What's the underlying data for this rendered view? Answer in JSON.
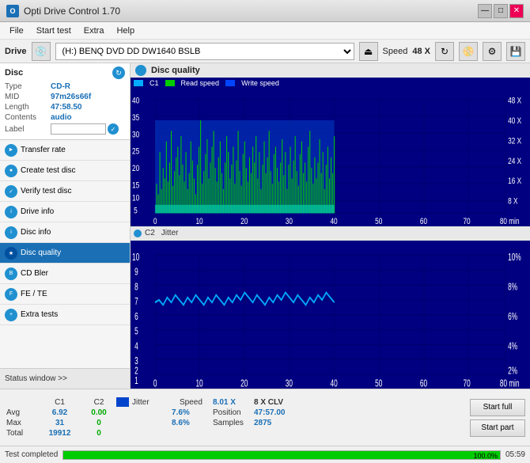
{
  "titleBar": {
    "title": "Opti Drive Control 1.70",
    "controls": [
      "—",
      "□",
      "✕"
    ]
  },
  "menuBar": {
    "items": [
      "File",
      "Start test",
      "Extra",
      "Help"
    ]
  },
  "driveBar": {
    "label": "Drive",
    "driveValue": "(H:)  BENQ DVD DD DW1640 BSLB",
    "speedLabel": "Speed",
    "speedValue": "48 X"
  },
  "disc": {
    "header": "Disc",
    "typeLabel": "Type",
    "typeValue": "CD-R",
    "midLabel": "MID",
    "midValue": "97m26s66f",
    "lengthLabel": "Length",
    "lengthValue": "47:58.50",
    "contentsLabel": "Contents",
    "contentsValue": "audio",
    "labelLabel": "Label",
    "labelValue": ""
  },
  "sidebarItems": [
    {
      "id": "transfer-rate",
      "label": "Transfer rate"
    },
    {
      "id": "create-test-disc",
      "label": "Create test disc"
    },
    {
      "id": "verify-test-disc",
      "label": "Verify test disc"
    },
    {
      "id": "drive-info",
      "label": "Drive info"
    },
    {
      "id": "disc-info",
      "label": "Disc info"
    },
    {
      "id": "disc-quality",
      "label": "Disc quality",
      "active": true
    },
    {
      "id": "cd-bler",
      "label": "CD Bler"
    },
    {
      "id": "fe-te",
      "label": "FE / TE"
    },
    {
      "id": "extra-tests",
      "label": "Extra tests"
    }
  ],
  "statusWindowLabel": "Status window >>",
  "chartTitle": "Disc quality",
  "legend": {
    "c1Label": "C1",
    "readSpeedLabel": "Read speed",
    "writeSpeedLabel": "Write speed"
  },
  "chart1": {
    "yMax": 40,
    "yAxisLabels": [
      "40",
      "35",
      "30",
      "25",
      "20",
      "15",
      "10",
      "5"
    ],
    "yAxisRight": [
      "48 X",
      "40 X",
      "32 X",
      "24 X",
      "16 X",
      "8 X"
    ],
    "xLabels": [
      "0",
      "10",
      "20",
      "30",
      "40",
      "50",
      "60",
      "70",
      "80"
    ]
  },
  "chart2": {
    "label": "C2",
    "jitterLabel": "Jitter",
    "yMax": 10,
    "yAxisLabels": [
      "10",
      "9",
      "8",
      "7",
      "6",
      "5",
      "4",
      "3",
      "2",
      "1"
    ],
    "yAxisRight": [
      "10%",
      "8%",
      "6%",
      "4%",
      "2%"
    ],
    "xLabels": [
      "0",
      "10",
      "20",
      "30",
      "40",
      "50",
      "60",
      "70",
      "80"
    ]
  },
  "statsTable": {
    "headers": [
      "",
      "C1",
      "C2",
      "",
      "Jitter"
    ],
    "rows": [
      {
        "label": "Avg",
        "c1": "6.92",
        "c2": "0.00",
        "jitter": "7.6%"
      },
      {
        "label": "Max",
        "c1": "31",
        "c2": "0",
        "jitter": "8.6%"
      },
      {
        "label": "Total",
        "c1": "19912",
        "c2": "0",
        "jitter": ""
      }
    ]
  },
  "rightStats": {
    "speedLabel": "Speed",
    "speedValue": "8.01 X",
    "positionLabel": "Position",
    "positionValue": "47:57.00",
    "samplesLabel": "Samples",
    "samplesValue": "2875",
    "speedUnit": "8 X CLV"
  },
  "buttons": {
    "startFull": "Start full",
    "startPart": "Start part"
  },
  "statusBar": {
    "statusText": "Test completed",
    "progressPercent": 100,
    "progressLabel": "100.0%",
    "time": "05:59"
  },
  "jitterCheckbox": true,
  "jitterCheckLabel": "Jitter"
}
